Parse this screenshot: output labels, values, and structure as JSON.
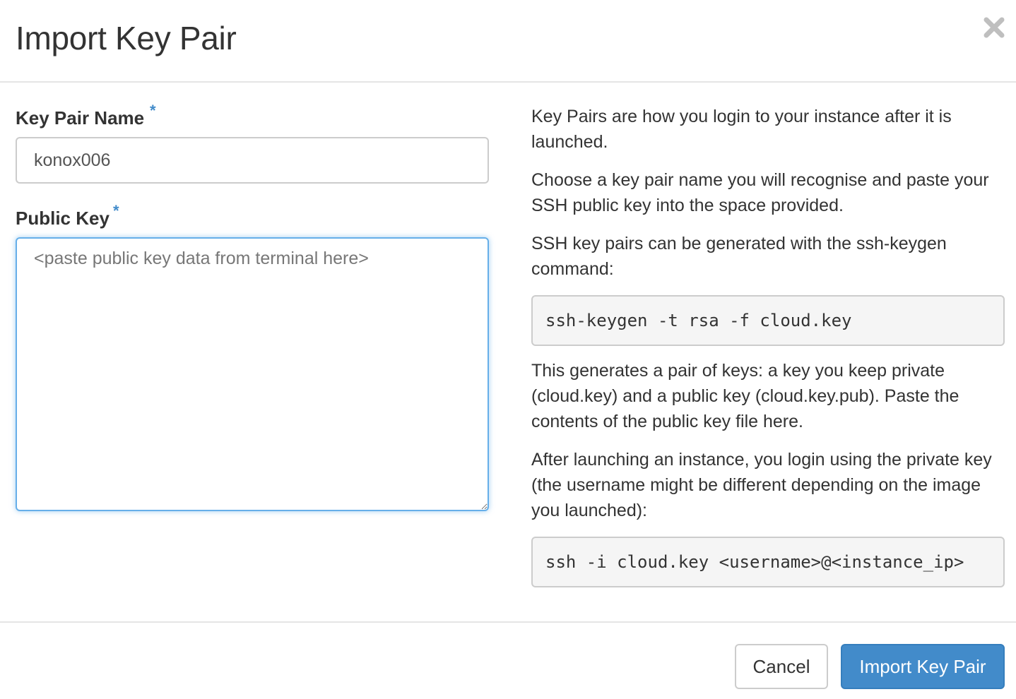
{
  "dialog": {
    "title": "Import Key Pair",
    "close_icon": "close-icon"
  },
  "form": {
    "key_pair_name": {
      "label": "Key Pair Name",
      "required_marker": "*",
      "value": "konox006"
    },
    "public_key": {
      "label": "Public Key",
      "required_marker": "*",
      "placeholder": "<paste public key data from terminal here>",
      "value": ""
    }
  },
  "help": {
    "paragraph_1": "Key Pairs are how you login to your instance after it is launched.",
    "paragraph_2": "Choose a key pair name you will recognise and paste your SSH public key into the space provided.",
    "paragraph_3": "SSH key pairs can be generated with the ssh-keygen command:",
    "code_1": "ssh-keygen -t rsa -f cloud.key",
    "paragraph_4": "This generates a pair of keys: a key you keep private (cloud.key) and a public key (cloud.key.pub). Paste the contents of the public key file here.",
    "paragraph_5": "After launching an instance, you login using the private key (the username might be different depending on the image you launched):",
    "code_2": "ssh -i cloud.key <username>@<instance_ip>"
  },
  "footer": {
    "cancel_label": "Cancel",
    "submit_label": "Import Key Pair"
  },
  "colors": {
    "primary": "#428bca",
    "required": "#428bca",
    "focus_border": "#66afe9"
  }
}
